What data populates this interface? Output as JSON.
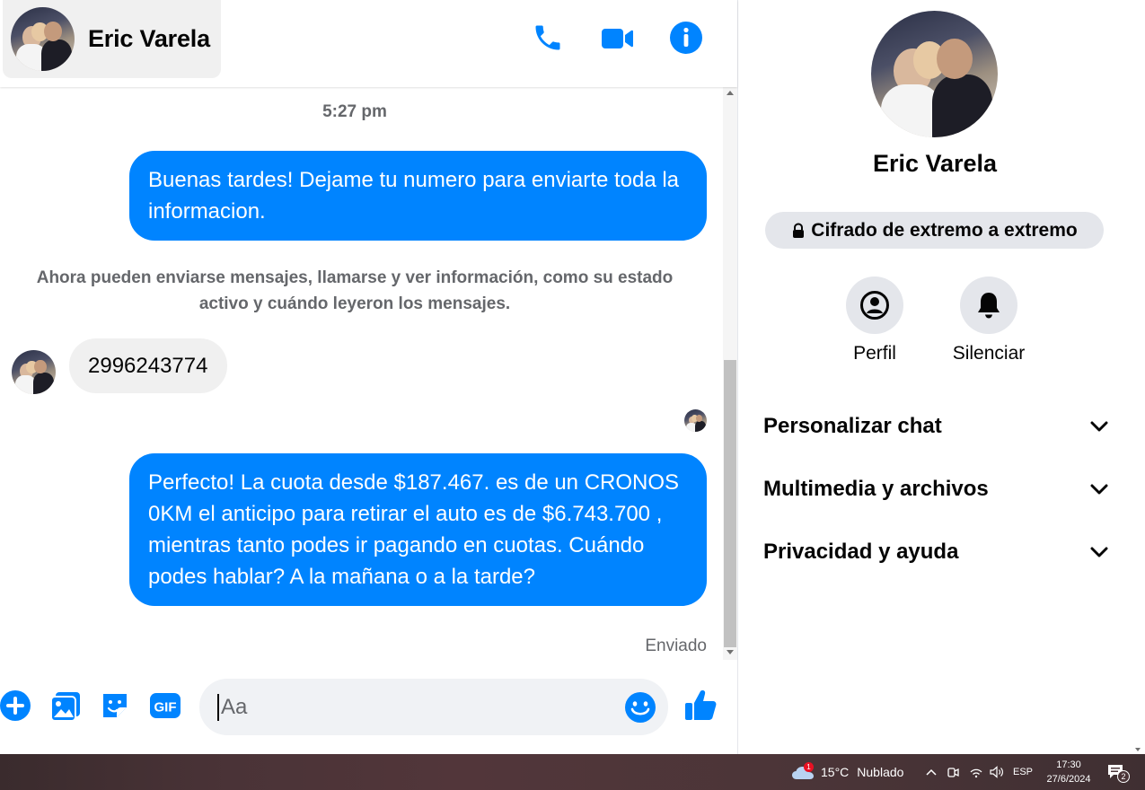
{
  "contact": {
    "name": "Eric Varela"
  },
  "conversation": {
    "timestamp": "5:27 pm",
    "messages": [
      {
        "direction": "out",
        "text": "Buenas tardes! Dejame tu numero para enviarte toda la informacion."
      },
      {
        "direction": "system",
        "text": "Ahora pueden enviarse mensajes, llamarse y ver información, como su estado activo y cuándo leyeron los mensajes."
      },
      {
        "direction": "in",
        "text": "2996243774"
      },
      {
        "direction": "out",
        "text": "Perfecto! La cuota desde $187.467. es de un CRONOS 0KM el anticipo para retirar el auto es de $6.743.700 , mientras tanto podes ir pagando en cuotas. Cuándo podes hablar? A la mañana o a la tarde?"
      }
    ],
    "status": "Enviado"
  },
  "composer": {
    "placeholder": "Aa"
  },
  "details": {
    "name": "Eric Varela",
    "encryption": "Cifrado de extremo a extremo",
    "actions": [
      {
        "label": "Perfil"
      },
      {
        "label": "Silenciar"
      }
    ],
    "sections": [
      {
        "label": "Personalizar chat"
      },
      {
        "label": "Multimedia y archivos"
      },
      {
        "label": "Privacidad y ayuda"
      }
    ]
  },
  "taskbar": {
    "weather_badge": "1",
    "temperature": "15°C",
    "condition": "Nublado",
    "language": "ESP",
    "time": "17:30",
    "date": "27/6/2024",
    "notifications": "2"
  },
  "colors": {
    "accent": "#0084ff",
    "bubble_in": "#f0f0f0",
    "secondary_text": "#65676b"
  },
  "icons": [
    "phone-icon",
    "video-camera-icon",
    "info-icon",
    "plus-icon",
    "image-icon",
    "sticker-icon",
    "gif-icon",
    "emoji-icon",
    "thumbs-up-icon",
    "lock-icon",
    "user-circle-icon",
    "bell-icon",
    "chevron-down-icon",
    "cloud-icon",
    "wifi-icon",
    "speaker-icon",
    "notification-icon"
  ]
}
